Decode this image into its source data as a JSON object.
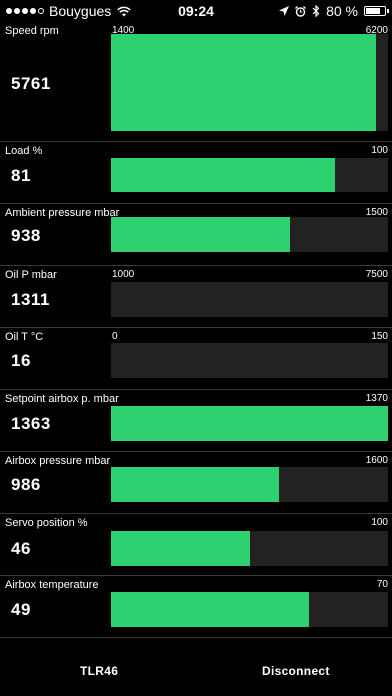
{
  "status_bar": {
    "carrier": "Bouygues",
    "time": "09:24",
    "battery": "80 %",
    "battery_level": 0.8,
    "signal_bars_filled": 4,
    "signal_bars_total": 5
  },
  "gauges": [
    {
      "label": "Speed rpm",
      "value": "5761",
      "min": "1400",
      "max": "6200",
      "fill": 0.955
    },
    {
      "label": "Load %",
      "value": "81",
      "min": "",
      "max": "100",
      "fill": 0.81
    },
    {
      "label": "Ambient pressure mbar",
      "value": "938",
      "min": "",
      "max": "1500",
      "fill": 0.645
    },
    {
      "label": "Oil P mbar",
      "value": "1311",
      "min": "1000",
      "max": "7500",
      "fill": 0.0
    },
    {
      "label": "Oil T °C",
      "value": "16",
      "min": "0",
      "max": "150",
      "fill": 0.0
    },
    {
      "label": "Setpoint airbox p. mbar",
      "value": "1363",
      "min": "",
      "max": "1370",
      "fill": 1.0
    },
    {
      "label": "Airbox pressure mbar",
      "value": "986",
      "min": "",
      "max": "1600",
      "fill": 0.605
    },
    {
      "label": "Servo position %",
      "value": "46",
      "min": "",
      "max": "100",
      "fill": 0.5
    },
    {
      "label": "Airbox temperature",
      "value": "49",
      "min": "",
      "max": "70",
      "fill": 0.715
    }
  ],
  "bottom_bar": {
    "left_label": "TLR46",
    "right_label": "Disconnect"
  },
  "colors": {
    "bar_fill": "#2fd070",
    "bar_track": "#222222",
    "background": "#000000"
  }
}
